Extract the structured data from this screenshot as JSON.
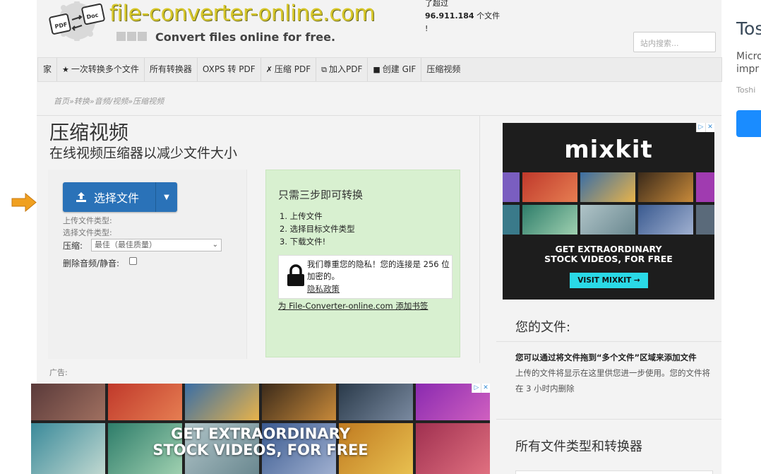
{
  "header": {
    "site_name": "file-converter-online.com",
    "tagline": "Convert files online for free.",
    "count_prefix": "了超过",
    "count_value": "96.911.184",
    "count_suffix": "个文件",
    "count_tail": "!",
    "search_placeholder": "站内搜索..."
  },
  "nav": {
    "items": [
      {
        "label": "家",
        "icon": ""
      },
      {
        "label": "一次转换多个文件",
        "icon": "star-icon"
      },
      {
        "label": "所有转换器",
        "icon": ""
      },
      {
        "label": "OXPS 转 PDF",
        "icon": ""
      },
      {
        "label": "压缩 PDF",
        "icon": "compress-icon"
      },
      {
        "label": "加入PDF",
        "icon": "merge-icon"
      },
      {
        "label": "创建 GIF",
        "icon": "video-icon"
      },
      {
        "label": "压缩视频",
        "icon": ""
      }
    ]
  },
  "breadcrumb": "首页»转换»音频/视频»压缩视频",
  "page": {
    "title": "压缩视频",
    "subtitle": "在线视频压缩器以减少文件大小"
  },
  "upload": {
    "button_label": "选择文件",
    "upload_type_label": "上传文件类型:",
    "select_type_label": "选择文件类型:",
    "compress_label": "压缩:",
    "compress_value": "最佳（最佳质量）",
    "mute_label": "删除音频/静音:"
  },
  "steps": {
    "title": "只需三步即可转换",
    "items": [
      "1. 上传文件",
      "2. 选择目标文件类型",
      "3. 下载文件!"
    ],
    "privacy_text": "我们尊重您的隐私！您的连接是 256 位加密的。",
    "privacy_link": "隐私政策",
    "bookmark": "为 File-Converter-online.com 添加书签"
  },
  "ad_right": {
    "brand": "mixkit",
    "headline_line1": "GET EXTRAORDINARY",
    "headline_line2": "STOCK VIDEOS, FOR FREE",
    "cta": "VISIT MIXKIT →"
  },
  "your_files": {
    "title": "您的文件:",
    "bold_text": "您可以通过将文件拖到“多个文件”区域来添加文件",
    "note": "上传的文件将显示在这里供您进一步使用。您的文件将在 3 小时内删除"
  },
  "all_types": {
    "title": "所有文件类型和转换器"
  },
  "ad_label": "广告:",
  "ad_bottom": {
    "headline_line1": "GET EXTRAORDINARY",
    "headline_line2": "STOCK VIDEOS, FOR FREE"
  },
  "edge": {
    "title": "Tos",
    "text1_line1": "Micro",
    "text1_line2": "impr",
    "text2": "Toshi"
  },
  "colors": {
    "primary_button": "#2a72b8",
    "steps_bg": "#d8f0d0",
    "logo_text": "#d7c72a",
    "cta": "#2ad9e6"
  }
}
